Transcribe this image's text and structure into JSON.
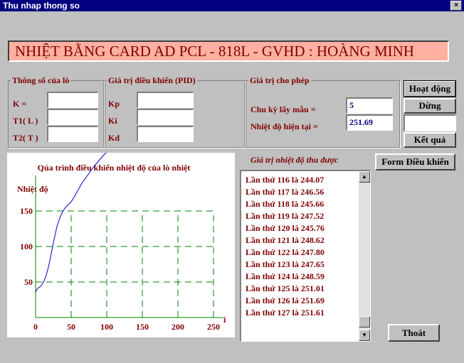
{
  "window": {
    "title": "Thu nhap thong so",
    "close_glyph": "×"
  },
  "banner": "NHIỆT BẰNG CARD AD PCL - 818L - GVHD : HOÀNG MINH",
  "furnace_params": {
    "label": "Thông số của lò",
    "k_label": "K  =",
    "t1_label": "T1( L )",
    "t2_label": "T2( T )",
    "k_value": "",
    "t1_value": "",
    "t2_value": ""
  },
  "pid_params": {
    "label": "Giá trị điều khiển (PID)",
    "kp_label": "Kp",
    "ki_label": "Ki",
    "kd_label": "Kd",
    "kp_value": "",
    "ki_value": "",
    "kd_value": ""
  },
  "allowed": {
    "label": "Giá trị cho phép",
    "sample_label": "Chu kỳ lấy mẫu =",
    "sample_value": "5",
    "temp_label": "Nhiệt độ hiện tại  =",
    "temp_value": "251.69"
  },
  "buttons": {
    "run": "Hoạt động",
    "stop": "Dừng",
    "result_value": "",
    "result": "Kết quả",
    "control_form": "Form Điều khiển",
    "exit": "Thoát"
  },
  "list": {
    "title": "Giá trị nhiệt độ thu được",
    "items": [
      "Lần thứ 116 là   244.07",
      "Lần thứ 117 là   246.56",
      "Lần thứ 118 là   245.66",
      "Lần thứ 119 là   247.52",
      "Lần thứ 120 là   245.76",
      "Lần thứ 121 là   248.62",
      "Lần thứ 122 là   247.80",
      "Lần thứ 123 là   247.65",
      "Lần thứ 124 là   248.59",
      "Lần thứ 125 là   251.01",
      "Lần thứ 126 là   251.69",
      "Lần thứ 127 là   251.61"
    ]
  },
  "colors": {
    "title_bar": "#000080",
    "banner_bg": "#ffb0a0",
    "label_text": "#800000",
    "curve": "#0000cc",
    "grid": "#008000"
  },
  "chart_data": {
    "type": "line",
    "title": "Qúa trình điều khiển nhiệt độ của lò nhiệt",
    "ylabel": "Nhiệt độ",
    "xlabel": "i",
    "xlim": [
      0,
      250
    ],
    "ylim": [
      0,
      200
    ],
    "x_ticks": [
      0,
      50,
      100,
      150,
      200,
      250
    ],
    "y_ticks": [
      50,
      100,
      150
    ],
    "grid": true,
    "series": [
      {
        "x": [
          0,
          2,
          4,
          6,
          8,
          10,
          12,
          14,
          16,
          18,
          20,
          22,
          24,
          26,
          28,
          30,
          34,
          38,
          42,
          46,
          50,
          55,
          60,
          65,
          70,
          75,
          80,
          85,
          90,
          95,
          100,
          105,
          110,
          115,
          120,
          127
        ],
        "y": [
          36,
          40,
          42,
          43,
          45,
          48,
          52,
          57,
          63,
          71,
          80,
          90,
          100,
          110,
          119,
          128,
          140,
          149,
          155,
          159,
          163,
          171,
          180,
          189,
          196,
          203,
          210,
          216,
          222,
          228,
          233,
          237,
          241,
          244,
          247,
          252
        ]
      }
    ]
  }
}
